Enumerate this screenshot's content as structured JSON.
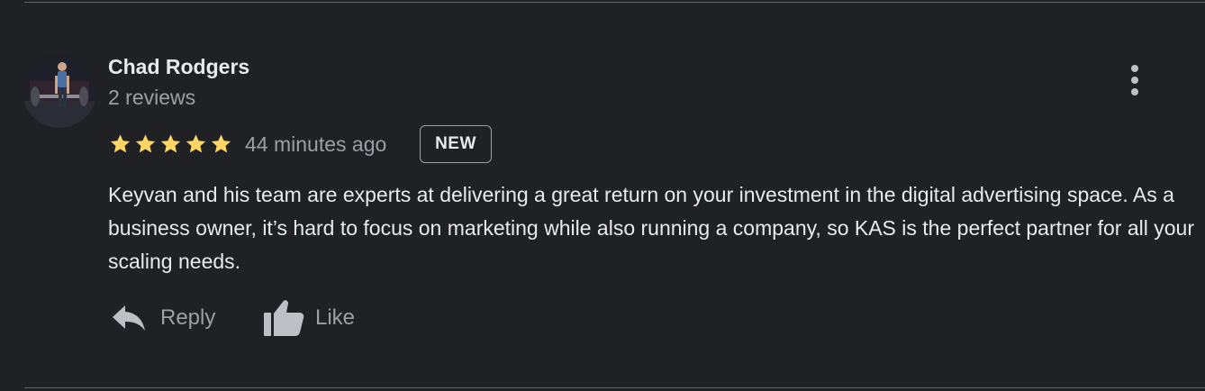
{
  "review": {
    "author_name": "Chad Rodgers",
    "author_reviews": "2 reviews",
    "rating": 5,
    "rating_max": 5,
    "time_ago": "44 minutes ago",
    "badge": "NEW",
    "text": "Keyvan and his team are experts at delivering a great return on your investment in the digital advertising space. As a business owner, it’s hard to focus on marketing while also running a company, so KAS is the perfect partner for all your scaling needs.",
    "more_icon": "more-vertical-icon"
  },
  "actions": {
    "reply_label": "Reply",
    "reply_icon": "reply-arrow-icon",
    "like_label": "Like",
    "like_icon": "thumbs-up-icon"
  },
  "colors": {
    "background": "#202124",
    "primary_text": "#e8eaed",
    "secondary_text": "#9aa0a6",
    "star": "#fdd663",
    "divider": "#5f6368"
  }
}
